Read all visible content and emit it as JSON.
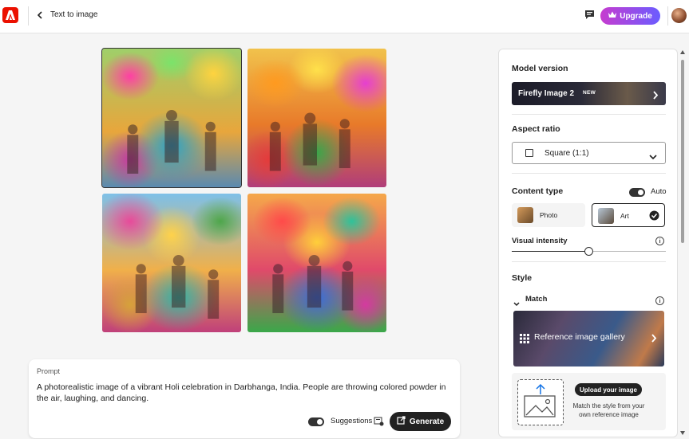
{
  "header": {
    "page_title": "Text to image",
    "upgrade_label": "Upgrade"
  },
  "images": [
    {
      "name": "generated-image-1"
    },
    {
      "name": "generated-image-2"
    },
    {
      "name": "generated-image-3"
    },
    {
      "name": "generated-image-4"
    }
  ],
  "prompt": {
    "label": "Prompt",
    "text": "A photorealistic image of a vibrant Holi celebration in Darbhanga, India. People are throwing colored powder in the air, laughing, and dancing.",
    "suggestions_label": "Suggestions",
    "suggestions_enabled": true,
    "generate_label": "Generate"
  },
  "panel": {
    "model_version": {
      "heading": "Model version",
      "value": "Firefly Image 2",
      "badge": "NEW"
    },
    "aspect_ratio": {
      "heading": "Aspect ratio",
      "value": "Square (1:1)"
    },
    "content_type": {
      "heading": "Content type",
      "auto_label": "Auto",
      "auto_enabled": true,
      "options": [
        {
          "label": "Photo",
          "selected": false
        },
        {
          "label": "Art",
          "selected": true
        }
      ]
    },
    "visual_intensity": {
      "heading": "Visual intensity",
      "level": 0.5
    },
    "style": {
      "heading": "Style",
      "match_label": "Match",
      "reference_gallery_label": "Reference image gallery",
      "upload_button_label": "Upload your image",
      "upload_description": "Match the style from your own reference image"
    }
  },
  "colors": {
    "brand_red": "#eb1000",
    "upgrade_gradient_start": "#c63ccf",
    "upgrade_gradient_end": "#6b5cff",
    "dark_button": "#222222"
  },
  "icons": {
    "logo": "adobe-logo-icon",
    "back": "chevron-left-icon",
    "chat": "chat-icon",
    "crown": "crown-icon",
    "dropdown": "chevron-down-icon",
    "info": "info-icon",
    "check": "checkmark-circle-icon",
    "grid": "grid-icon",
    "upload": "image-upload-icon",
    "generate": "generate-icon",
    "suggestions": "suggestions-icon"
  }
}
